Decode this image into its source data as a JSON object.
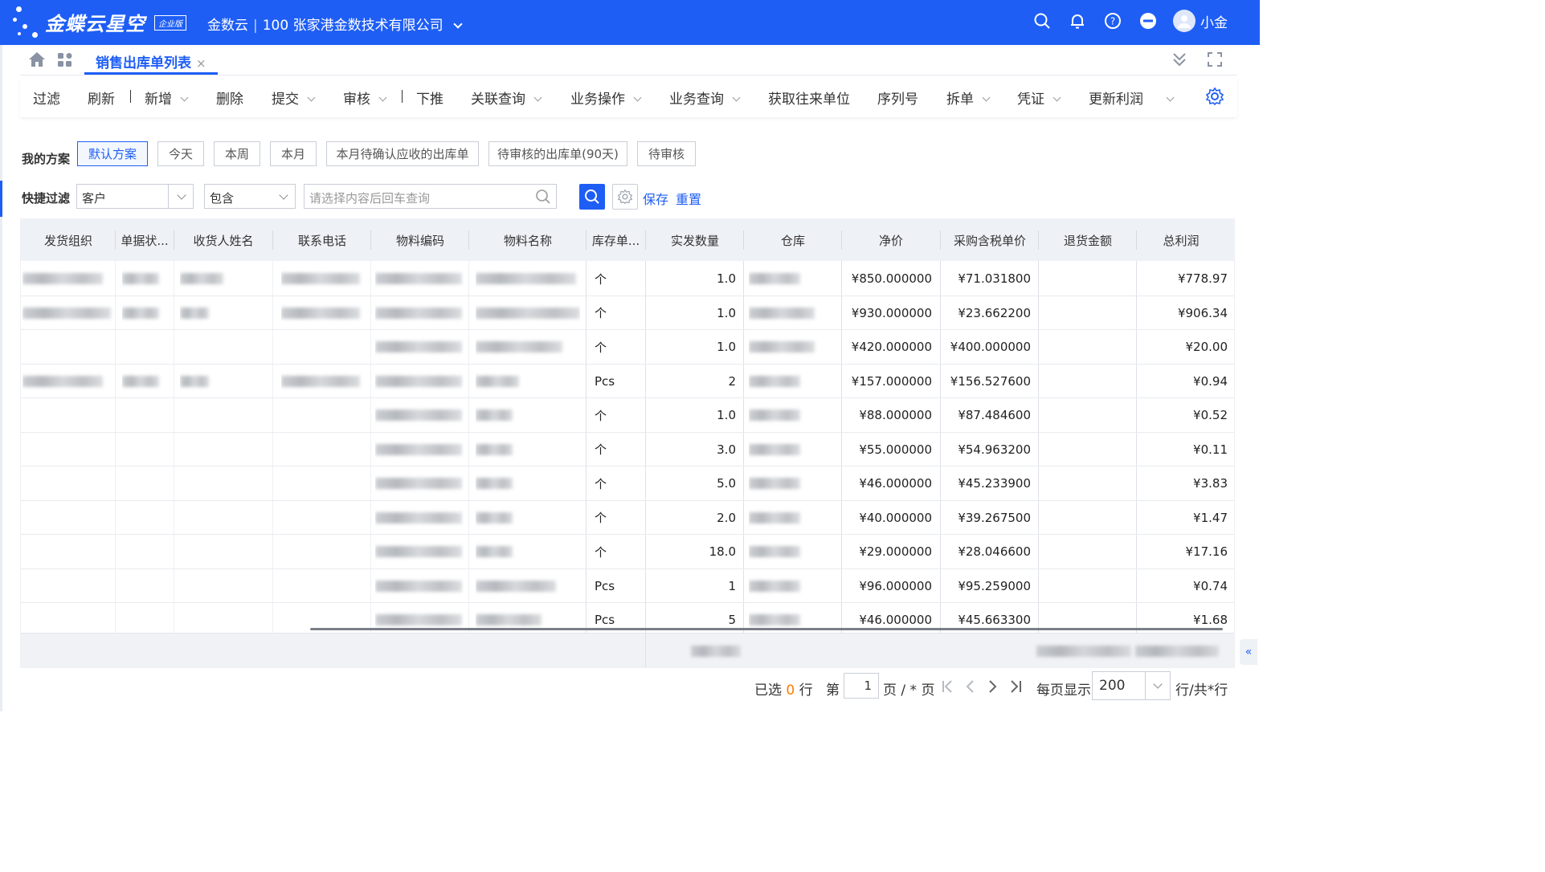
{
  "app": {
    "logo_text": "金蝶云星空",
    "edition_badge": "企业版",
    "product": "金数云",
    "company": "100 张家港金数技术有限公司",
    "user": "小金"
  },
  "top_icons": [
    "search-icon",
    "bell-icon",
    "help-icon",
    "minus-circle-icon",
    "avatar"
  ],
  "tabs": {
    "active": "销售出库单列表",
    "close": "×"
  },
  "toolbar": [
    {
      "label": "过滤",
      "dropdown": false
    },
    {
      "label": "刷新",
      "dropdown": false
    },
    {
      "label": "新增",
      "dropdown": true
    },
    {
      "label": "删除",
      "dropdown": false
    },
    {
      "label": "提交",
      "dropdown": true
    },
    {
      "label": "审核",
      "dropdown": true
    },
    {
      "label": "下推",
      "dropdown": false
    },
    {
      "label": "关联查询",
      "dropdown": true
    },
    {
      "label": "业务操作",
      "dropdown": true
    },
    {
      "label": "业务查询",
      "dropdown": true
    },
    {
      "label": "获取往来单位",
      "dropdown": false
    },
    {
      "label": "序列号",
      "dropdown": false
    },
    {
      "label": "拆单",
      "dropdown": true
    },
    {
      "label": "凭证",
      "dropdown": true
    },
    {
      "label": "更新利润",
      "dropdown": true
    }
  ],
  "filters": {
    "scheme_label": "我的方案",
    "schemes": [
      "默认方案",
      "今天",
      "本周",
      "本月",
      "本月待确认应收的出库单",
      "待审核的出库单(90天)",
      "待审核"
    ],
    "quick_label": "快捷过滤",
    "field": "客户",
    "operator": "包含",
    "search_placeholder": "请选择内容后回车查询",
    "save": "保存",
    "reset": "重置"
  },
  "grid": {
    "columns": [
      "发货组织",
      "单据状...",
      "收货人姓名",
      "联系电话",
      "物料编码",
      "物料名称",
      "库存单...",
      "实发数量",
      "仓库",
      "净价",
      "采购含税单价",
      "退货金额",
      "总利润"
    ],
    "rows": [
      {
        "unit": "个",
        "qty": "1.0",
        "price": "¥850.000000",
        "purchase": "¥71.031800",
        "profit": "¥778.97"
      },
      {
        "unit": "个",
        "qty": "1.0",
        "price": "¥930.000000",
        "purchase": "¥23.662200",
        "profit": "¥906.34"
      },
      {
        "unit": "个",
        "qty": "1.0",
        "price": "¥420.000000",
        "purchase": "¥400.000000",
        "profit": "¥20.00"
      },
      {
        "unit": "Pcs",
        "qty": "2",
        "price": "¥157.000000",
        "purchase": "¥156.527600",
        "profit": "¥0.94"
      },
      {
        "unit": "个",
        "qty": "1.0",
        "price": "¥88.000000",
        "purchase": "¥87.484600",
        "profit": "¥0.52"
      },
      {
        "unit": "个",
        "qty": "3.0",
        "price": "¥55.000000",
        "purchase": "¥54.963200",
        "profit": "¥0.11"
      },
      {
        "unit": "个",
        "qty": "5.0",
        "price": "¥46.000000",
        "purchase": "¥45.233900",
        "profit": "¥3.83"
      },
      {
        "unit": "个",
        "qty": "2.0",
        "price": "¥40.000000",
        "purchase": "¥39.267500",
        "profit": "¥1.47"
      },
      {
        "unit": "个",
        "qty": "18.0",
        "price": "¥29.000000",
        "purchase": "¥28.046600",
        "profit": "¥17.16"
      },
      {
        "unit": "Pcs",
        "qty": "1",
        "price": "¥96.000000",
        "purchase": "¥95.259000",
        "profit": "¥0.74"
      },
      {
        "unit": "Pcs",
        "qty": "5",
        "price": "¥46.000000",
        "purchase": "¥45.663300",
        "profit": "¥1.68"
      }
    ]
  },
  "pager": {
    "selected_prefix": "已选",
    "selected_count": "0",
    "selected_suffix": "行",
    "page_prefix": "第",
    "page": "1",
    "page_suffix": "页 / * 页",
    "per_page_label": "每页显示",
    "per_page": "200",
    "total": "行/共*行"
  },
  "colors": {
    "brand": "#1e5ef5",
    "orange": "#ff7a00"
  }
}
